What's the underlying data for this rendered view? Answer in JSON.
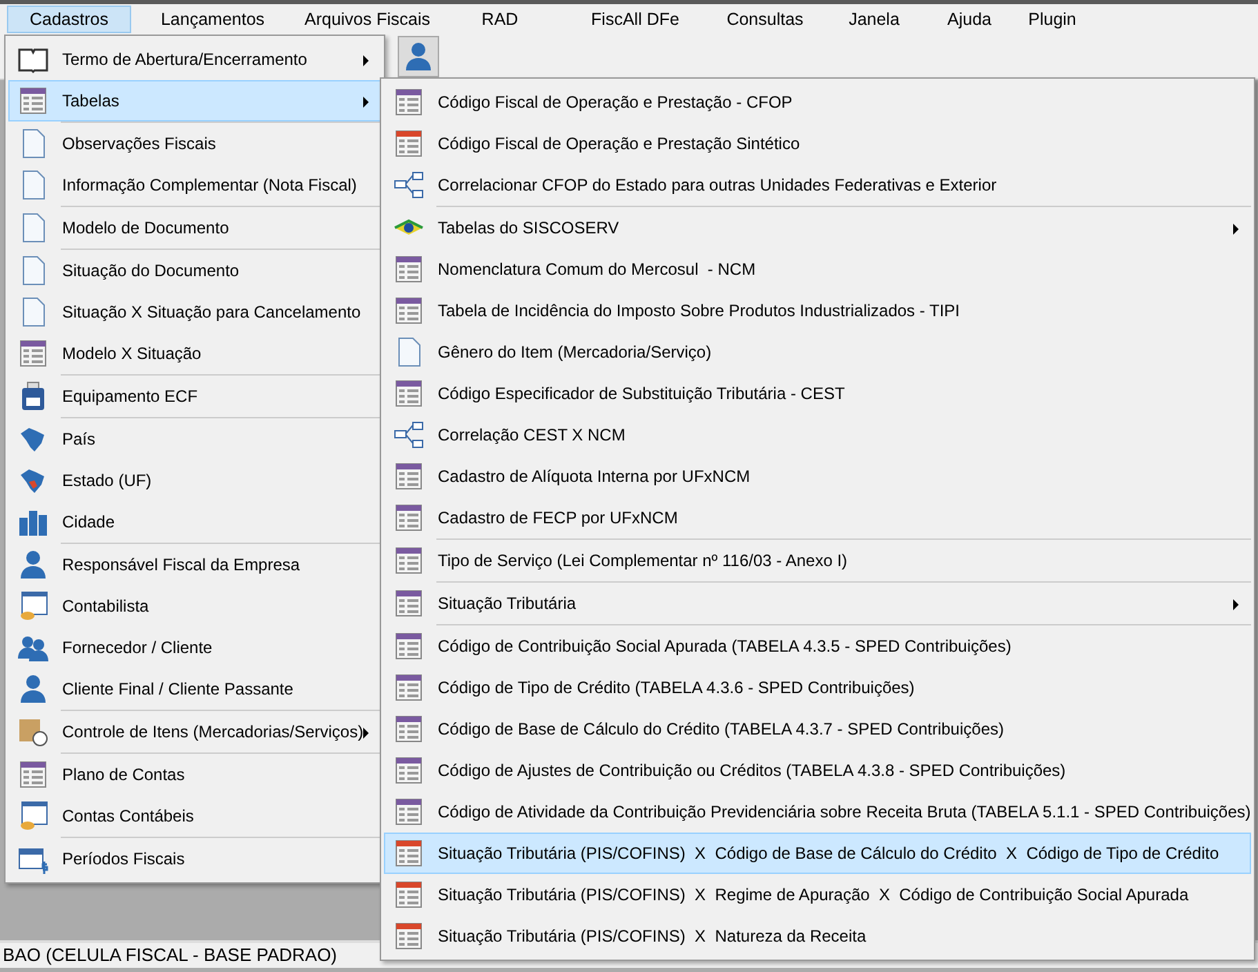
{
  "menu_bar": [
    {
      "label": "Cadastros",
      "selected": true
    },
    {
      "label": "Lançamentos",
      "selected": false
    },
    {
      "label": "Arquivos Fiscais",
      "selected": false
    },
    {
      "label": "RAD",
      "selected": false
    },
    {
      "label": "FiscAll DFe",
      "selected": false
    },
    {
      "label": "Consultas",
      "selected": false
    },
    {
      "label": "Janela",
      "selected": false
    },
    {
      "label": "Ajuda",
      "selected": false
    },
    {
      "label": "Plugin",
      "selected": false
    }
  ],
  "cadastros_menu": {
    "groups": [
      [
        {
          "label": "Termo de Abertura/Encerramento",
          "submenu": true,
          "selected": false
        },
        {
          "label": "Tabelas",
          "submenu": true,
          "selected": true
        }
      ],
      [
        {
          "label": "Observações Fiscais",
          "submenu": false,
          "selected": false
        },
        {
          "label": "Informação Complementar (Nota Fiscal)",
          "submenu": false,
          "selected": false
        }
      ],
      [
        {
          "label": "Modelo de Documento",
          "submenu": false,
          "selected": false
        }
      ],
      [
        {
          "label": "Situação do Documento",
          "submenu": false,
          "selected": false
        },
        {
          "label": "Situação X Situação para Cancelamento",
          "submenu": false,
          "selected": false
        },
        {
          "label": "Modelo X Situação",
          "submenu": false,
          "selected": false
        }
      ],
      [
        {
          "label": "Equipamento ECF",
          "submenu": false,
          "selected": false
        }
      ],
      [
        {
          "label": "País",
          "submenu": false,
          "selected": false
        },
        {
          "label": "Estado (UF)",
          "submenu": false,
          "selected": false
        },
        {
          "label": "Cidade",
          "submenu": false,
          "selected": false
        }
      ],
      [
        {
          "label": "Responsável Fiscal da Empresa",
          "submenu": false,
          "selected": false
        },
        {
          "label": "Contabilista",
          "submenu": false,
          "selected": false
        },
        {
          "label": "Fornecedor / Cliente",
          "submenu": false,
          "selected": false
        },
        {
          "label": "Cliente Final / Cliente Passante",
          "submenu": false,
          "selected": false
        }
      ],
      [
        {
          "label": "Controle de Itens (Mercadorias/Serviços)",
          "submenu": true,
          "selected": false
        }
      ],
      [
        {
          "label": "Plano de Contas",
          "submenu": false,
          "selected": false
        },
        {
          "label": "Contas Contábeis",
          "submenu": false,
          "selected": false
        }
      ],
      [
        {
          "label": "Períodos Fiscais",
          "submenu": false,
          "selected": false
        }
      ]
    ]
  },
  "tabelas_submenu": {
    "groups": [
      [
        {
          "label": "Código Fiscal de Operação e Prestação - CFOP",
          "submenu": false,
          "selected": false
        },
        {
          "label": "Código Fiscal de Operação e Prestação Sintético",
          "submenu": false,
          "selected": false
        },
        {
          "label": "Correlacionar CFOP do Estado para outras Unidades Federativas e Exterior",
          "submenu": false,
          "selected": false
        }
      ],
      [
        {
          "label": "Tabelas do SISCOSERV",
          "submenu": true,
          "selected": false
        },
        {
          "label": "Nomenclatura Comum do Mercosul  - NCM",
          "submenu": false,
          "selected": false
        },
        {
          "label": "Tabela de Incidência do Imposto Sobre Produtos Industrializados - TIPI",
          "submenu": false,
          "selected": false
        },
        {
          "label": "Gênero do Item (Mercadoria/Serviço)",
          "submenu": false,
          "selected": false
        },
        {
          "label": "Código Especificador de Substituição Tributária - CEST",
          "submenu": false,
          "selected": false
        },
        {
          "label": "Correlação CEST X NCM",
          "submenu": false,
          "selected": false
        },
        {
          "label": "Cadastro de Alíquota Interna por UFxNCM",
          "submenu": false,
          "selected": false
        },
        {
          "label": "Cadastro de FECP por UFxNCM",
          "submenu": false,
          "selected": false
        }
      ],
      [
        {
          "label": "Tipo de Serviço (Lei Complementar nº 116/03 - Anexo I)",
          "submenu": false,
          "selected": false
        }
      ],
      [
        {
          "label": "Situação Tributária",
          "submenu": true,
          "selected": false
        }
      ],
      [
        {
          "label": "Código de Contribuição Social Apurada (TABELA 4.3.5 - SPED Contribuições)",
          "submenu": false,
          "selected": false
        },
        {
          "label": "Código de Tipo de Crédito (TABELA 4.3.6 - SPED Contribuições)",
          "submenu": false,
          "selected": false
        },
        {
          "label": "Código de Base de Cálculo do Crédito (TABELA 4.3.7 - SPED Contribuições)",
          "submenu": false,
          "selected": false
        },
        {
          "label": "Código de Ajustes de Contribuição ou Créditos (TABELA 4.3.8 - SPED Contribuições)",
          "submenu": false,
          "selected": false
        },
        {
          "label": "Código de Atividade da Contribuição Previdenciária sobre Receita Bruta (TABELA 5.1.1 - SPED Contribuições)",
          "submenu": false,
          "selected": false
        },
        {
          "label": "Situação Tributária (PIS/COFINS)  X  Código de Base de Cálculo do Crédito  X  Código de Tipo de Crédito",
          "submenu": false,
          "selected": true
        },
        {
          "label": "Situação Tributária (PIS/COFINS)  X  Regime de Apuração  X  Código de Contribuição Social Apurada",
          "submenu": false,
          "selected": false
        },
        {
          "label": "Situação Tributária (PIS/COFINS)  X  Natureza da Receita",
          "submenu": false,
          "selected": false
        }
      ]
    ]
  },
  "status_bar": {
    "text": "BAO (CELULA FISCAL - BASE PADRAO)"
  }
}
